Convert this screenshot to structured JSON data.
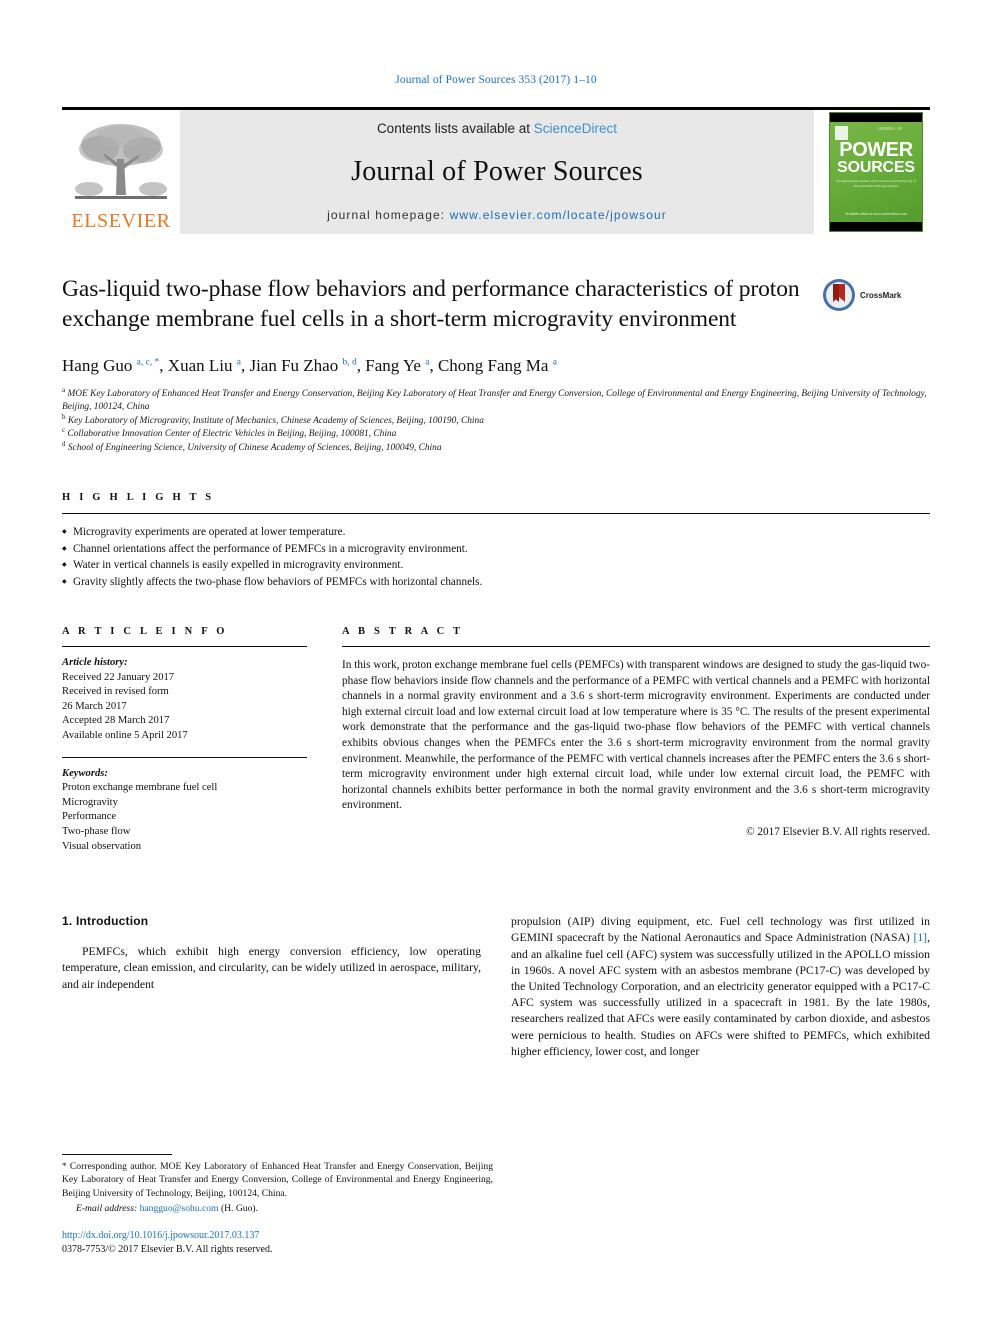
{
  "running_head": "Journal of Power Sources 353 (2017) 1–10",
  "masthead": {
    "elsevier_wordmark": "ELSEVIER",
    "contents_prefix": "Contents lists available at ",
    "contents_link": "ScienceDirect",
    "journal_name": "Journal of Power Sources",
    "homepage_prefix": "journal homepage: ",
    "homepage_url": "www.elsevier.com/locate/jpowsour",
    "cover": {
      "title_line1": "POWER",
      "title_line2": "SOURCES",
      "kicker": "JOURNAL OF",
      "subtitle": "An International Journal on the Science and Technology of Electrochemical Energy Systems",
      "footer": "Available online at\nwww.sciencedirect.com"
    }
  },
  "article": {
    "title": "Gas-liquid two-phase flow behaviors and performance characteristics of proton exchange membrane fuel cells in a short-term microgravity environment",
    "crossmark_label": "CrossMark",
    "authors": [
      {
        "name": "Hang Guo",
        "sup": "a, c, *"
      },
      {
        "name": "Xuan Liu",
        "sup": "a"
      },
      {
        "name": "Jian Fu Zhao",
        "sup": "b, d"
      },
      {
        "name": "Fang Ye",
        "sup": "a"
      },
      {
        "name": "Chong Fang Ma",
        "sup": "a"
      }
    ],
    "affiliations": [
      {
        "marker": "a",
        "text": "MOE Key Laboratory of Enhanced Heat Transfer and Energy Conservation, Beijing Key Laboratory of Heat Transfer and Energy Conversion, College of Environmental and Energy Engineering, Beijing University of Technology, Beijing, 100124, China"
      },
      {
        "marker": "b",
        "text": "Key Laboratory of Microgravity, Institute of Mechanics, Chinese Academy of Sciences, Beijing, 100190, China"
      },
      {
        "marker": "c",
        "text": "Collaborative Innovation Center of Electric Vehicles in Beijing, Beijing, 100081, China"
      },
      {
        "marker": "d",
        "text": "School of Engineering Science, University of Chinese Academy of Sciences, Beijing, 100049, China"
      }
    ]
  },
  "highlights": {
    "label": "H I G H L I G H T S",
    "items": [
      "Microgravity experiments are operated at lower temperature.",
      "Channel orientations affect the performance of PEMFCs in a microgravity environment.",
      "Water in vertical channels is easily expelled in microgravity environment.",
      "Gravity slightly affects the two-phase flow behaviors of PEMFCs with horizontal channels."
    ]
  },
  "article_info": {
    "label": "A R T I C L E   I N F O",
    "history_header": "Article history:",
    "history": [
      "Received 22 January 2017",
      "Received in revised form",
      "26 March 2017",
      "Accepted 28 March 2017",
      "Available online 5 April 2017"
    ],
    "keywords_header": "Keywords:",
    "keywords": [
      "Proton exchange membrane fuel cell",
      "Microgravity",
      "Performance",
      "Two-phase flow",
      "Visual observation"
    ]
  },
  "abstract": {
    "label": "A B S T R A C T",
    "text": "In this work, proton exchange membrane fuel cells (PEMFCs) with transparent windows are designed to study the gas-liquid two-phase flow behaviors inside flow channels and the performance of a PEMFC with vertical channels and a PEMFC with horizontal channels in a normal gravity environment and a 3.6 s short-term microgravity environment. Experiments are conducted under high external circuit load and low external circuit load at low temperature where is 35 °C. The results of the present experimental work demonstrate that the performance and the gas-liquid two-phase flow behaviors of the PEMFC with vertical channels exhibits obvious changes when the PEMFCs enter the 3.6 s short-term microgravity environment from the normal gravity environment. Meanwhile, the performance of the PEMFC with vertical channels increases after the PEMFC enters the 3.6 s short-term microgravity environment under high external circuit load, while under low external circuit load, the PEMFC with horizontal channels exhibits better performance in both the normal gravity environment and the 3.6 s short-term microgravity environment.",
    "copyright": "© 2017 Elsevier B.V. All rights reserved."
  },
  "body": {
    "section_title": "1. Introduction",
    "left_paragraph": "PEMFCs, which exhibit high energy conversion efficiency, low operating temperature, clean emission, and circularity, can be widely utilized in aerospace, military, and air independent",
    "right_paragraph_part1": "propulsion (AIP) diving equipment, etc. Fuel cell technology was first utilized in GEMINI spacecraft by the National Aeronautics and Space Administration (NASA) ",
    "right_reference": "[1]",
    "right_paragraph_part2": ", and an alkaline fuel cell (AFC) system was successfully utilized in the APOLLO mission in 1960s. A novel AFC system with an asbestos membrane (PC17-C) was developed by the United Technology Corporation, and an electricity generator equipped with a PC17-C AFC system was successfully utilized in a spacecraft in 1981. By the late 1980s, researchers realized that AFCs were easily contaminated by carbon dioxide, and asbestos were pernicious to health. Studies on AFCs were shifted to PEMFCs, which exhibited higher efficiency, lower cost, and longer"
  },
  "footnotes": {
    "corresponding_marker": "*",
    "corresponding_text": "Corresponding author. MOE Key Laboratory of Enhanced Heat Transfer and Energy Conservation, Beijing Key Laboratory of Heat Transfer and Energy Conversion, College of Environmental and Energy Engineering, Beijing University of Technology, Beijing, 100124, China.",
    "email_label": "E-mail address:",
    "email": "hangguo@sohu.com",
    "email_suffix": "(H. Guo).",
    "doi": "http://dx.doi.org/10.1016/j.jpowsour.2017.03.137",
    "issn_line": "0378-7753/© 2017 Elsevier B.V. All rights reserved."
  },
  "colors": {
    "link": "#1a6fb5",
    "elsevier_orange": "#E87722",
    "cover_green": "#6aae3c"
  }
}
